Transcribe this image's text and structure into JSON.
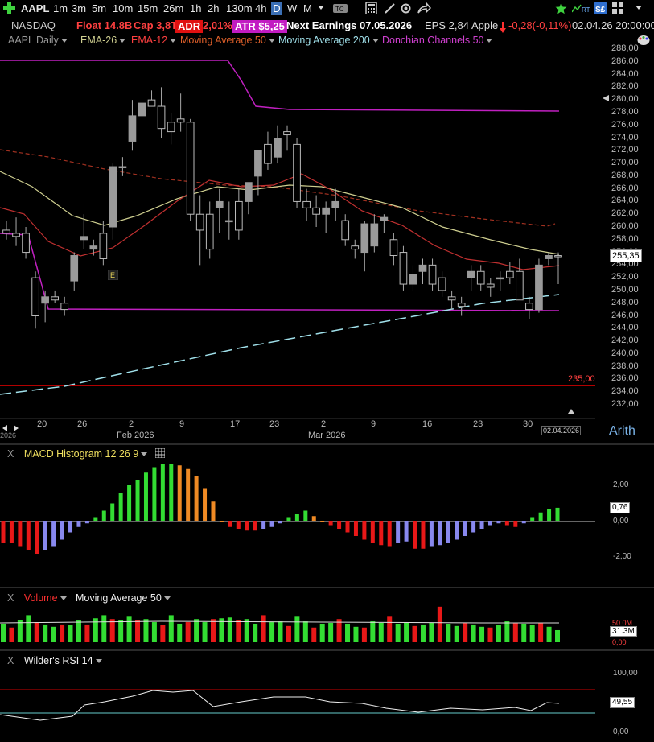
{
  "toolbar": {
    "symbol": "AAPL",
    "timeframes": [
      "1m",
      "3m",
      "5m",
      "10m",
      "15m",
      "26m",
      "1h",
      "2h",
      "130m",
      "4h"
    ],
    "selected_tf": "D",
    "after_tf": [
      "W",
      "M"
    ],
    "quotes_icon_rt": "RT",
    "sf_icon": "S£"
  },
  "info": {
    "exchange": "NASDAQ",
    "float": "Float 14.8B",
    "cap": "Cap 3,8T",
    "adr_label": "ADR",
    "adr_value": "2,01%",
    "atr": "ATR $5,25",
    "earnings": "Next Earnings 07.05.2026",
    "eps": "EPS 2,84",
    "name": "Apple",
    "change": "-0,28(-0,11%)",
    "datetime": "02.04.26 20:00:00"
  },
  "studies": {
    "chart_name": "AAPL Daily",
    "ema26": "EMA-26",
    "ema12": "EMA-12",
    "ma50": "Moving Average 50",
    "ma200": "Moving Average 200",
    "donchian": "Donchian Channels 50"
  },
  "colors": {
    "up": "#5ee06a",
    "down": "#ff4040",
    "donchian": "#c020c0",
    "ma200": "#a0e0ea",
    "ema12": "#c03030",
    "ma50": "#a03020",
    "ema26": "#cfcf90"
  },
  "price_axis": {
    "ticks": [
      "288,00",
      "286,00",
      "284,00",
      "282,00",
      "280,00",
      "278,00",
      "276,00",
      "274,00",
      "272,00",
      "270,00",
      "268,00",
      "266,00",
      "264,00",
      "262,00",
      "260,00",
      "258,00",
      "256,00",
      "254,00",
      "252,00",
      "250,00",
      "248,00",
      "246,00",
      "244,00",
      "242,00",
      "240,00",
      "238,00",
      "236,00",
      "234,00",
      "232,00"
    ],
    "last_price": "255,35",
    "level_label": "235,00",
    "scale_mode": "Arith"
  },
  "time_axis": {
    "days": [
      "20",
      "26",
      "2",
      "9",
      "17",
      "23",
      "2",
      "9",
      "16",
      "23",
      "30"
    ],
    "month_feb": "Feb 2026",
    "month_mar": "Mar 2026",
    "year_stub": "2026",
    "cursor_date": "02.04.2026"
  },
  "earnings_marker": "E",
  "macd": {
    "title": "MACD Histogram 12 26 9",
    "close": "X",
    "ticks": [
      "2,00",
      "0,00",
      "-2,00"
    ],
    "last": "0,76"
  },
  "volume": {
    "title": "Volume",
    "ma_title": "Moving Average 50",
    "close": "X",
    "tick_ma": "50.0M",
    "last": "31.3M",
    "tick_zero": "0,00"
  },
  "rsi": {
    "title": "Wilder's RSI 14",
    "close": "X",
    "tick_top": "100,00",
    "last": "49,55",
    "tick_zero": "0,00"
  },
  "chart_data": {
    "type": "candlestick",
    "candles": [
      {
        "o": 259.5,
        "h": 261,
        "l": 258,
        "c": 259
      },
      {
        "o": 259,
        "h": 261.5,
        "l": 257,
        "c": 258.5
      },
      {
        "o": 259,
        "h": 260,
        "l": 255,
        "c": 256
      },
      {
        "o": 252,
        "h": 253,
        "l": 244,
        "c": 246
      },
      {
        "o": 248,
        "h": 250,
        "l": 245,
        "c": 249
      },
      {
        "o": 249,
        "h": 250,
        "l": 248,
        "c": 248.5
      },
      {
        "o": 248,
        "h": 249,
        "l": 246,
        "c": 247
      },
      {
        "o": 251.5,
        "h": 256,
        "l": 250,
        "c": 255.5
      },
      {
        "o": 258,
        "h": 262,
        "l": 256.5,
        "c": 258.5
      },
      {
        "o": 256.5,
        "h": 258,
        "l": 255.5,
        "c": 257
      },
      {
        "o": 259,
        "h": 261,
        "l": 254,
        "c": 255
      },
      {
        "o": 260,
        "h": 270,
        "l": 258,
        "c": 269.5
      },
      {
        "o": 269.5,
        "h": 271,
        "l": 268,
        "c": 269.5
      },
      {
        "o": 273.5,
        "h": 280,
        "l": 272,
        "c": 277.5
      },
      {
        "o": 277.5,
        "h": 281,
        "l": 274,
        "c": 279.5
      },
      {
        "o": 280,
        "h": 281.5,
        "l": 279,
        "c": 279
      },
      {
        "o": 279,
        "h": 282,
        "l": 274,
        "c": 275.5
      },
      {
        "o": 276.5,
        "h": 278,
        "l": 273,
        "c": 275
      },
      {
        "o": 277,
        "h": 281,
        "l": 275,
        "c": 276.5
      },
      {
        "o": 276.5,
        "h": 277,
        "l": 261,
        "c": 262
      },
      {
        "o": 262,
        "h": 265,
        "l": 254,
        "c": 259.5
      },
      {
        "o": 262,
        "h": 264,
        "l": 255,
        "c": 256.5
      },
      {
        "o": 263,
        "h": 266,
        "l": 259,
        "c": 264
      },
      {
        "o": 261,
        "h": 264,
        "l": 258,
        "c": 261
      },
      {
        "o": 264,
        "h": 266,
        "l": 258,
        "c": 259.5
      },
      {
        "o": 264,
        "h": 267,
        "l": 262,
        "c": 267
      },
      {
        "o": 268,
        "h": 272,
        "l": 265,
        "c": 272
      },
      {
        "o": 273,
        "h": 275,
        "l": 269,
        "c": 270
      },
      {
        "o": 271,
        "h": 276,
        "l": 270,
        "c": 274
      },
      {
        "o": 275,
        "h": 276,
        "l": 272,
        "c": 274.5
      },
      {
        "o": 273,
        "h": 274,
        "l": 263,
        "c": 264
      },
      {
        "o": 264,
        "h": 266,
        "l": 261,
        "c": 263
      },
      {
        "o": 263,
        "h": 265,
        "l": 260,
        "c": 262
      },
      {
        "o": 262,
        "h": 264,
        "l": 259,
        "c": 263
      },
      {
        "o": 263,
        "h": 266,
        "l": 261,
        "c": 264
      },
      {
        "o": 261,
        "h": 262,
        "l": 257,
        "c": 258
      },
      {
        "o": 257,
        "h": 258,
        "l": 255,
        "c": 256.5
      },
      {
        "o": 256,
        "h": 261,
        "l": 253,
        "c": 260.5
      },
      {
        "o": 257,
        "h": 262,
        "l": 256,
        "c": 260.5
      },
      {
        "o": 261,
        "h": 262,
        "l": 259,
        "c": 261.5
      },
      {
        "o": 258,
        "h": 259,
        "l": 254,
        "c": 255.5
      },
      {
        "o": 256,
        "h": 257,
        "l": 250,
        "c": 251
      },
      {
        "o": 251,
        "h": 254,
        "l": 250,
        "c": 252.5
      },
      {
        "o": 253,
        "h": 255,
        "l": 251,
        "c": 254
      },
      {
        "o": 254,
        "h": 255,
        "l": 250,
        "c": 251
      },
      {
        "o": 252,
        "h": 253,
        "l": 249,
        "c": 250
      },
      {
        "o": 249,
        "h": 250,
        "l": 247,
        "c": 248.5
      },
      {
        "o": 248,
        "h": 249,
        "l": 246,
        "c": 247.5
      },
      {
        "o": 252,
        "h": 254,
        "l": 250,
        "c": 253
      },
      {
        "o": 253,
        "h": 254,
        "l": 250,
        "c": 251
      },
      {
        "o": 251,
        "h": 252,
        "l": 249,
        "c": 250.5
      },
      {
        "o": 252,
        "h": 253,
        "l": 250,
        "c": 252
      },
      {
        "o": 253,
        "h": 254.5,
        "l": 251,
        "c": 252
      },
      {
        "o": 253,
        "h": 255,
        "l": 249,
        "c": 248.5
      },
      {
        "o": 248,
        "h": 249,
        "l": 245.5,
        "c": 247
      },
      {
        "o": 247,
        "h": 255,
        "l": 246.5,
        "c": 254
      },
      {
        "o": 255,
        "h": 256,
        "l": 254,
        "c": 255.5
      },
      {
        "o": 255.5,
        "h": 256,
        "l": 251,
        "c": 255.35
      }
    ],
    "ylim": [
      232,
      288
    ],
    "macd_hist": [
      -1.2,
      -1.2,
      -1.4,
      -1.6,
      -1.8,
      -1.6,
      -1.4,
      -1.0,
      -0.6,
      -0.3,
      -0.1,
      0.2,
      0.6,
      1.0,
      1.6,
      2.0,
      2.3,
      2.7,
      3.0,
      3.2,
      3.2,
      3.1,
      2.9,
      2.5,
      1.8,
      1.1,
      0,
      -0.3,
      -0.4,
      -0.5,
      -0.5,
      -0.4,
      -0.3,
      -0.1,
      0.2,
      0.4,
      0.6,
      0.3,
      0,
      -0.2,
      -0.4,
      -0.6,
      -0.8,
      -1.0,
      -1.2,
      -1.3,
      -1.4,
      -1.2,
      -1.1,
      -1.5,
      -1.5,
      -1.4,
      -1.3,
      -1.2,
      -1.0,
      -0.8,
      -0.6,
      -0.4,
      -0.2,
      -0.1,
      -0.2,
      -0.3,
      -0.1,
      0.2,
      0.5,
      0.7,
      0.76
    ],
    "volume": [
      48,
      38,
      58,
      70,
      52,
      46,
      40,
      46,
      44,
      58,
      46,
      62,
      70,
      60,
      58,
      66,
      58,
      60,
      52,
      44,
      70,
      48,
      52,
      60,
      52,
      60,
      62,
      64,
      58,
      60,
      48,
      70,
      52,
      54,
      42,
      66,
      54,
      38,
      48,
      50,
      60,
      48,
      40,
      38,
      54,
      50,
      66,
      48,
      50,
      42,
      46,
      50,
      92,
      48,
      42,
      50,
      46,
      40,
      38,
      44,
      54,
      50,
      48,
      44,
      50,
      40,
      31.3
    ]
  }
}
